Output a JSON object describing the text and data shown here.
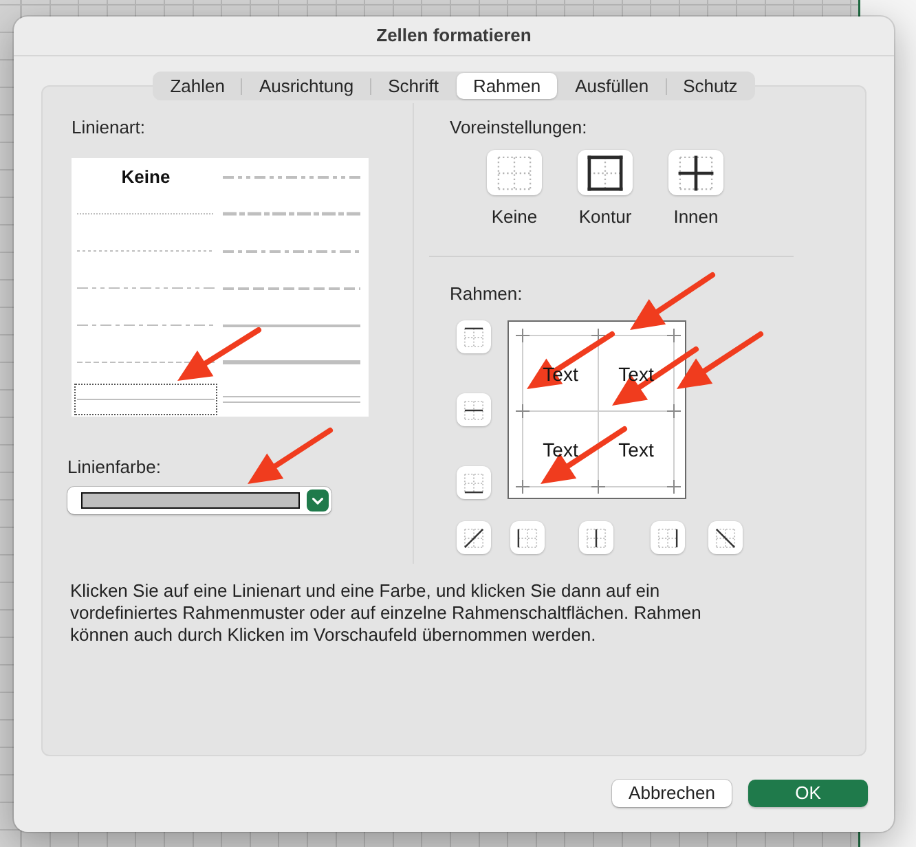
{
  "window": {
    "title": "Zellen formatieren"
  },
  "tabs": [
    {
      "label": "Zahlen",
      "selected": false
    },
    {
      "label": "Ausrichtung",
      "selected": false
    },
    {
      "label": "Schrift",
      "selected": false
    },
    {
      "label": "Rahmen",
      "selected": true
    },
    {
      "label": "Ausfüllen",
      "selected": false
    },
    {
      "label": "Schutz",
      "selected": false
    }
  ],
  "line_style": {
    "label": "Linienart:",
    "styles": [
      {
        "kind": "none",
        "label": "Keine",
        "selected": false
      },
      {
        "kind": "hair",
        "selected": false
      },
      {
        "kind": "dotted",
        "selected": false
      },
      {
        "kind": "dash-dot-dot",
        "selected": false
      },
      {
        "kind": "dash-dot",
        "selected": false
      },
      {
        "kind": "dashed",
        "selected": false
      },
      {
        "kind": "thin",
        "selected": true
      },
      {
        "kind": "medium-dash-dot-dot",
        "selected": false
      },
      {
        "kind": "slant-dash-dot",
        "selected": false
      },
      {
        "kind": "medium-dash-dot",
        "selected": false
      },
      {
        "kind": "medium-dashed",
        "selected": false
      },
      {
        "kind": "medium",
        "selected": false
      },
      {
        "kind": "thick",
        "selected": false
      },
      {
        "kind": "double",
        "selected": false
      }
    ]
  },
  "line_color": {
    "label": "Linienfarbe:",
    "color": "#bfbfbf"
  },
  "presets": {
    "label": "Voreinstellungen:",
    "items": [
      {
        "kind": "none",
        "label": "Keine"
      },
      {
        "kind": "outline",
        "label": "Kontur"
      },
      {
        "kind": "inside",
        "label": "Innen"
      }
    ]
  },
  "border": {
    "label": "Rahmen:",
    "side_buttons": [
      {
        "kind": "top"
      },
      {
        "kind": "middle"
      },
      {
        "kind": "bottom"
      }
    ],
    "preview_cells": [
      "Text",
      "Text",
      "Text",
      "Text"
    ],
    "bottom_buttons": [
      {
        "kind": "diagonal-up"
      },
      {
        "kind": "left"
      },
      {
        "kind": "center"
      },
      {
        "kind": "right"
      },
      {
        "kind": "diagonal-down"
      }
    ]
  },
  "hint": "Klicken Sie auf eine Linienart und eine Farbe, und klicken Sie dann auf ein vordefiniertes Rahmenmuster oder auf einzelne Rahmenschaltflächen. Rahmen können auch durch Klicken im Vorschaufeld übernommen werden.",
  "buttons": [
    {
      "label": "Abbrechen",
      "kind": "secondary"
    },
    {
      "label": "OK",
      "kind": "primary"
    }
  ]
}
